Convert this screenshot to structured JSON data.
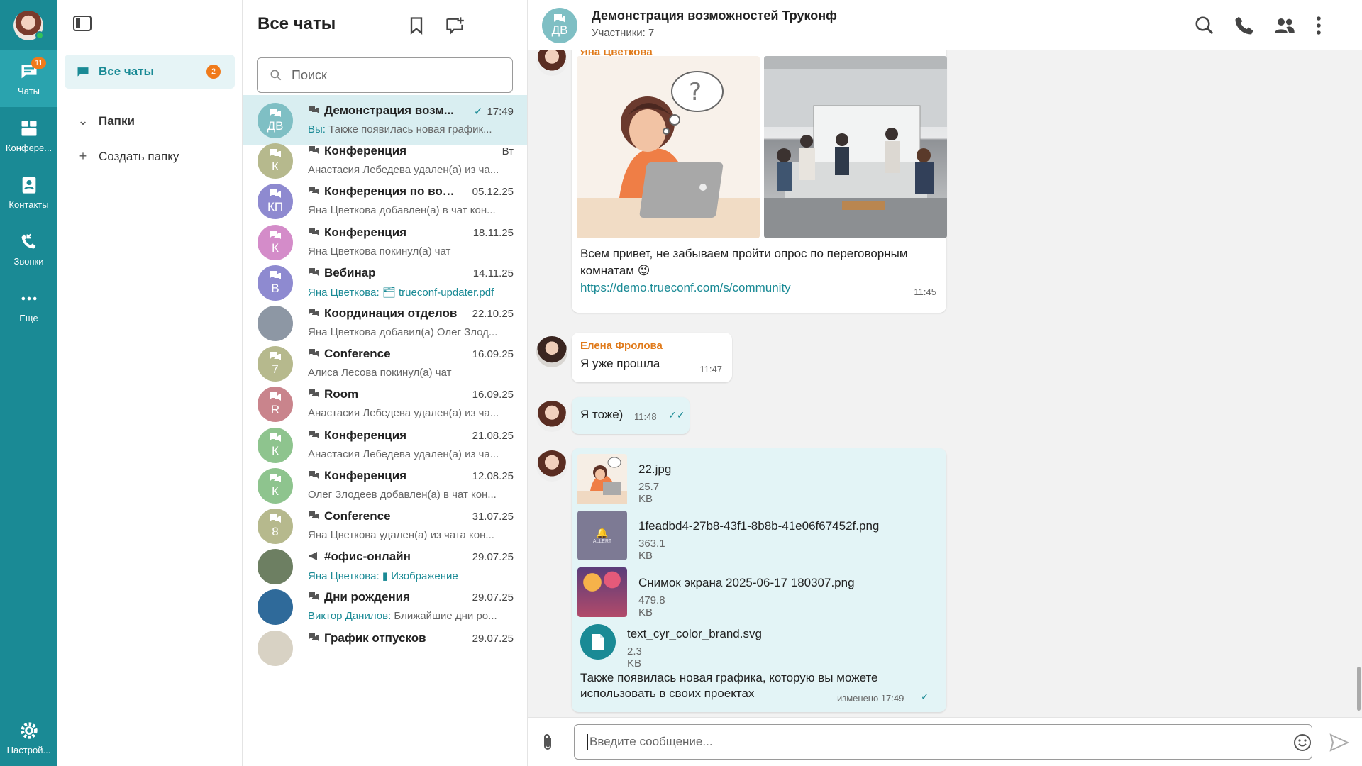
{
  "colors": {
    "accent": "#1a8a95",
    "badge": "#f07a1a",
    "active_row": "#d9eef1",
    "sender_name": "#e07a1a"
  },
  "rail": {
    "chats_badge": "11",
    "items": [
      {
        "label": "Чаты",
        "icon": "chat-bubble-icon"
      },
      {
        "label": "Конфере...",
        "icon": "conference-icon"
      },
      {
        "label": "Контакты",
        "icon": "contacts-icon"
      },
      {
        "label": "Звонки",
        "icon": "calls-icon"
      },
      {
        "label": "Еще",
        "icon": "more-dots-icon"
      }
    ],
    "settings_label": "Настрой..."
  },
  "folders": {
    "all_label": "Все чаты",
    "all_badge": "2",
    "folders_label": "Папки",
    "create_label": "Создать папку"
  },
  "chatlist": {
    "title": "Все чаты",
    "search_placeholder": "Поиск",
    "chats": [
      {
        "initials": "ДВ",
        "color": "#7fbfc4",
        "name": "Демонстрация возм...",
        "time": "17:49",
        "checked": true,
        "who": "Вы:",
        "preview": " Также появилась новая график...",
        "attach": ""
      },
      {
        "initials": "К",
        "color": "#b6b98d",
        "name": "Конференция",
        "time": "Вт",
        "who": "",
        "preview": "Анастасия Лебедева удален(а) из ча...",
        "attach": ""
      },
      {
        "initials": "КП",
        "color": "#8e8ad0",
        "name": "Конференция по вопр...",
        "time": "05.12.25",
        "who": "",
        "preview": "Яна Цветкова добавлен(а) в чат кон...",
        "attach": ""
      },
      {
        "initials": "К",
        "color": "#d48cc9",
        "name": "Конференция",
        "time": "18.11.25",
        "who": "",
        "preview": "Яна Цветкова покинул(а) чат",
        "attach": ""
      },
      {
        "initials": "В",
        "color": "#8e8ad0",
        "name": "Вебинар",
        "time": "14.11.25",
        "who": "Яна Цветкова:",
        "preview": "",
        "attach": "trueconf-updater.pdf"
      },
      {
        "initials": "",
        "color": "#8d97a4",
        "name": "Координация отделов",
        "time": "22.10.25",
        "who": "",
        "preview": "Яна Цветкова добавил(а) Олег Злод...",
        "attach": ""
      },
      {
        "initials": "7",
        "color": "#b6b98d",
        "name": "Conference",
        "time": "16.09.25",
        "who": "",
        "preview": "Алиса Лесова покинул(а) чат",
        "attach": ""
      },
      {
        "initials": "R",
        "color": "#c9848c",
        "name": "Room",
        "time": "16.09.25",
        "who": "",
        "preview": "Анастасия Лебедева удален(а) из ча...",
        "attach": ""
      },
      {
        "initials": "К",
        "color": "#8ec48e",
        "name": "Конференция",
        "time": "21.08.25",
        "who": "",
        "preview": "Анастасия Лебедева удален(а) из ча...",
        "attach": ""
      },
      {
        "initials": "К",
        "color": "#8ec48e",
        "name": "Конференция",
        "time": "12.08.25",
        "who": "",
        "preview": "Олег Злодеев добавлен(а) в чат кон...",
        "attach": ""
      },
      {
        "initials": "8",
        "color": "#b6b98d",
        "name": "Conference",
        "time": "31.07.25",
        "who": "",
        "preview": "Яна Цветкова удален(а) из чата кон...",
        "attach": ""
      },
      {
        "initials": "",
        "color": "#6d7f62",
        "name": "#офис-онлайн",
        "time": "29.07.25",
        "who": "Яна Цветкова:",
        "preview": "",
        "attach": "Изображение"
      },
      {
        "initials": "",
        "color": "#2f6a9a",
        "name": "Дни рождения",
        "time": "29.07.25",
        "who": "Виктор Данилов:",
        "preview": " Ближайшие дни ро...",
        "attach": ""
      },
      {
        "initials": "",
        "color": "#d8d2c4",
        "name": "График отпусков",
        "time": "29.07.25",
        "who": "",
        "preview": "",
        "attach": ""
      }
    ]
  },
  "header": {
    "initials": "ДВ",
    "title": "Демонстрация возможностей Труконф",
    "subtitle": "Участники: 7"
  },
  "messages": {
    "m1": {
      "sender": "Яна Цветкова",
      "text1": "Всем привет, не забываем пройти опрос по переговорным",
      "text2": "комнатам 😉",
      "link": "https://demo.trueconf.com/s/community",
      "time": "11:45"
    },
    "m2": {
      "sender": "Елена Фролова",
      "text": "Я уже прошла",
      "time": "11:47"
    },
    "m3": {
      "text": "Я тоже)",
      "time": "11:48"
    },
    "m4": {
      "files": [
        {
          "name": "22.jpg",
          "size": "25.7 KB"
        },
        {
          "name": "1feadbd4-27b8-43f1-8b8b-41e06f67452f.png",
          "size": "363.1 KB",
          "thumb_text": "ALLERT"
        },
        {
          "name": "Снимок экрана 2025-06-17 180307.png",
          "size": "479.8 KB"
        },
        {
          "name": "text_cyr_color_brand.svg",
          "size": "2.3 KB"
        }
      ],
      "text1": "Также появилась новая графика, которую вы можете",
      "text2": "использовать в своих проектах",
      "time": "изменено 17:49"
    }
  },
  "composer": {
    "placeholder": "Введите сообщение..."
  }
}
